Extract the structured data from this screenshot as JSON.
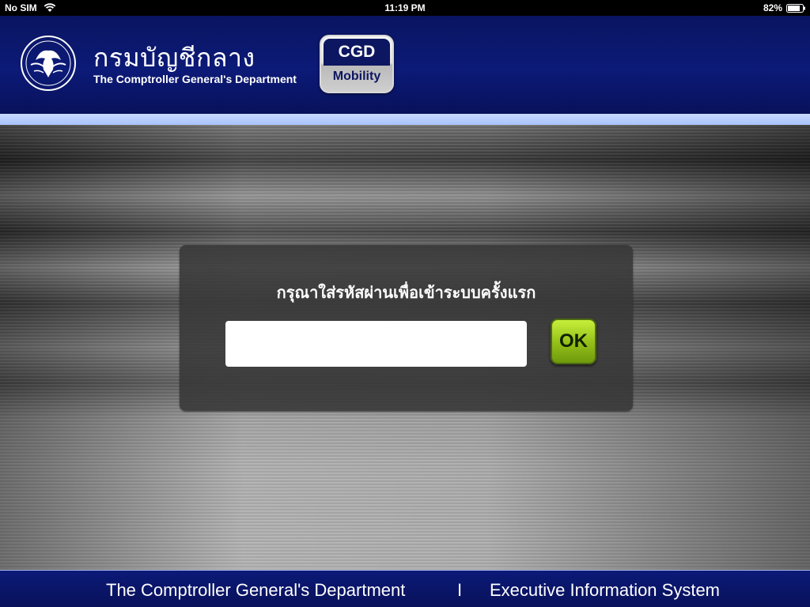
{
  "status_bar": {
    "carrier": "No SIM",
    "time": "11:19 PM",
    "battery": "82%"
  },
  "header": {
    "dept_thai": "กรมบัญชีกลาง",
    "dept_en": "The Comptroller General's Department",
    "badge_top": "CGD",
    "badge_bottom": "Mobility"
  },
  "login": {
    "prompt": "กรุณาใส่รหัสผ่านเพื่อเข้าระบบครั้งแรก",
    "password_value": "",
    "password_placeholder": "",
    "ok_label": "OK"
  },
  "footer": {
    "left": "The Comptroller General's Department",
    "separator": "I",
    "right": "Executive Information System"
  },
  "colors": {
    "header_blue": "#0c1a78",
    "ok_green": "#97c21a"
  }
}
